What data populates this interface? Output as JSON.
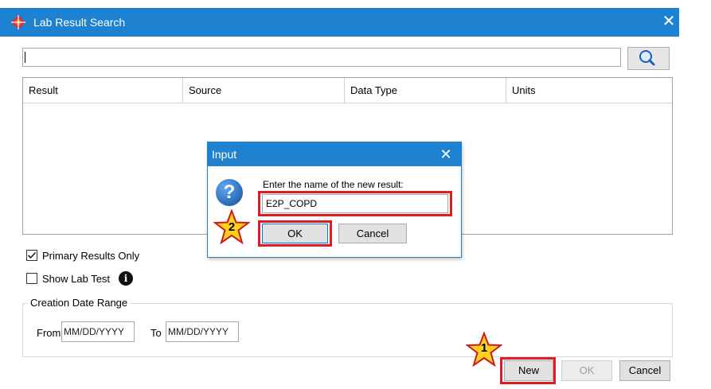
{
  "window": {
    "title": "Lab Result Search",
    "close_icon": "close-icon",
    "app_icon": "diamond-logo-icon",
    "accent": "#1f82d0"
  },
  "search": {
    "value": "",
    "button_icon": "magnifier-icon"
  },
  "table": {
    "columns": [
      "Result",
      "Source",
      "Data Type",
      "Units"
    ],
    "rows": []
  },
  "filters": {
    "primary_results_only": {
      "label": "Primary Results Only",
      "checked": true
    },
    "show_lab_test": {
      "label": "Show Lab Test",
      "checked": false,
      "info_icon": "info-icon"
    }
  },
  "date_range": {
    "title": "Creation Date Range",
    "from_label": "From",
    "from_placeholder": "MM/DD/YYYY",
    "to_label": "To",
    "to_placeholder": "MM/DD/YYYY"
  },
  "buttons": {
    "new": "New",
    "ok": "OK",
    "cancel": "Cancel"
  },
  "input_dialog": {
    "title": "Input",
    "prompt": "Enter the name of the new result:",
    "value": "E2P_COPD",
    "ok": "OK",
    "cancel": "Cancel",
    "icon": "question-icon"
  },
  "annotations": {
    "step1": "1",
    "step2": "2",
    "highlight_color": "#e01b24",
    "star_color": "#ffd21e"
  }
}
